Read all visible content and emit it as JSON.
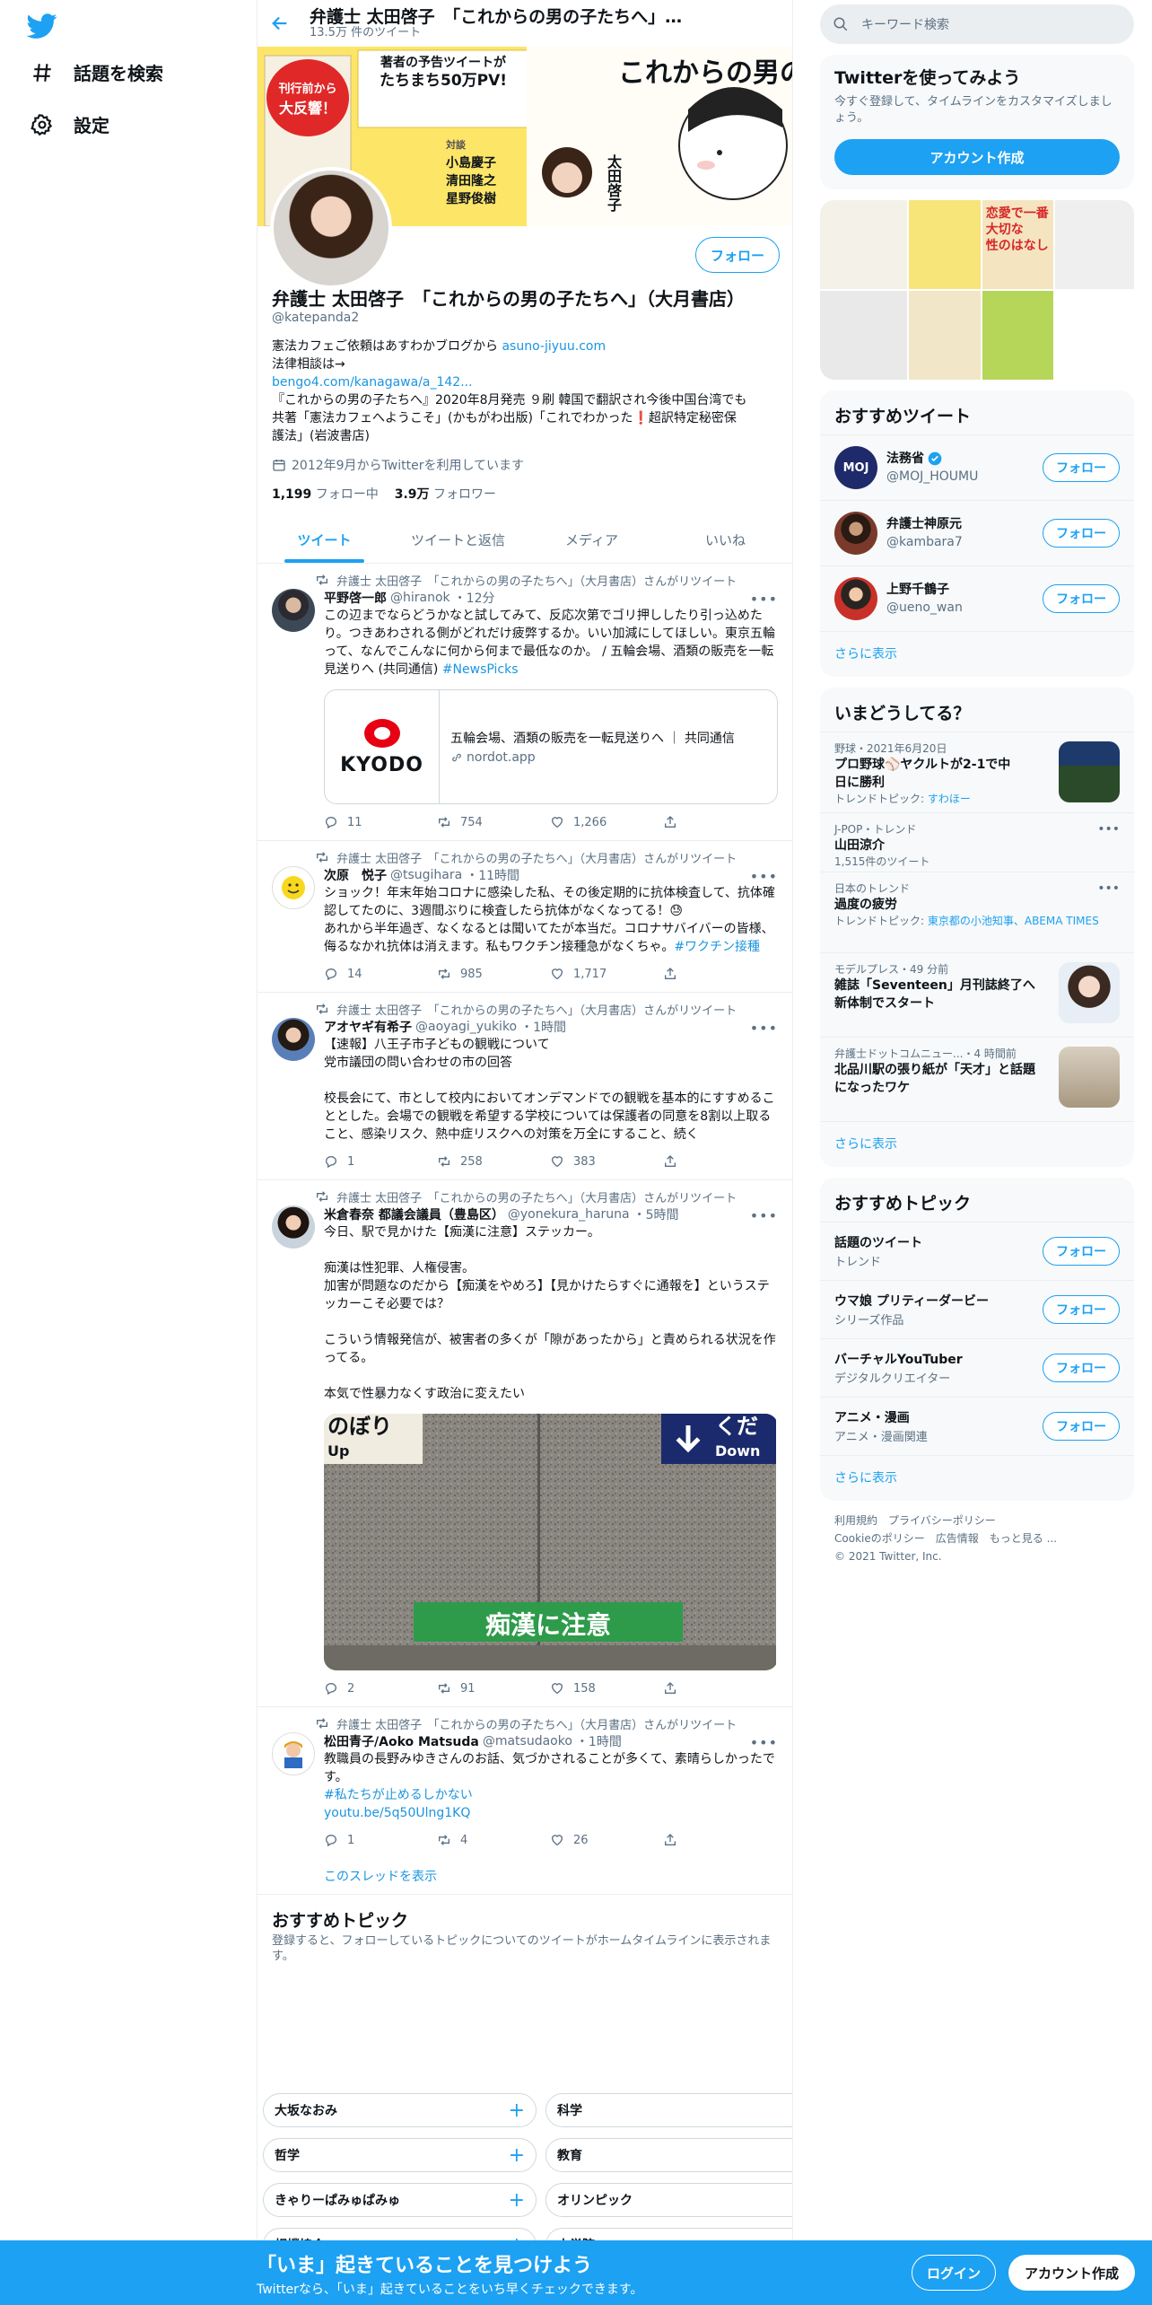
{
  "nav": {
    "logo_icon": "twitter-bird-icon",
    "items": [
      {
        "label": "話題を検索",
        "icon": "hashtag-icon"
      },
      {
        "label": "設定",
        "icon": "gear-icon"
      }
    ]
  },
  "header": {
    "title": "弁護士 太田啓子　「これからの男の子たちへ」…",
    "subtitle": "13.5万 件のツイート"
  },
  "banner": {
    "line1": "刊行前から",
    "line2": "大反響！",
    "line3": "著者の予告ツイートが",
    "line4": "たちまち50万PV!",
    "title": "これからの男の子たちへ",
    "names": [
      "小島慶子",
      "清田隆之",
      "星野俊樹",
      "太田啓子"
    ],
    "taidan": "対談"
  },
  "profile": {
    "follow_label": "フォロー",
    "name": "弁護士 太田啓子　「これからの男の子たちへ」（大月書店）",
    "handle": "@katepanda2",
    "bio_line1_text": "憲法カフェご依頼はあすわかブログから ",
    "bio_line1_link": "asuno-jiyuu.com",
    "bio_line2": "法律相談は→",
    "bio_line3_link": "bengo4.com/kanagawa/a_142...",
    "bio_line4": "『これからの男の子たちへ』2020年8月発売 ９刷 韓国で翻訳され今後中国台湾でも",
    "bio_line5": "共著「憲法カフェへようこそ」(かもがわ出版)「これでわかった❗️超訳特定秘密保",
    "bio_line6": "護法」(岩波書店)",
    "joined": "2012年9月からTwitterを利用しています",
    "following_count": "1,199",
    "following_label": "フォロー中",
    "followers_count": "3.9万",
    "followers_label": "フォロワー"
  },
  "tabs": [
    "ツイート",
    "ツイートと返信",
    "メディア",
    "いいね"
  ],
  "retweeted_by": "弁護士 太田啓子　「これからの男の子たちへ」（大月書店）さんがリツイート",
  "tweets": [
    {
      "name": "平野啓一郎",
      "handle": "@hiranok",
      "time": "・12分",
      "text": "この辺までならどうかなと試してみて、反応次第でゴリ押ししたり引っ込めたり。つきあわされる側がどれだけ疲弊するか。いい加減にしてほしい。東京五輪って、なんでこんなに何から何まで最低なのか。 / 五輪会場、酒類の販売を一転見送りへ (共同通信) ",
      "hashtag": "#NewsPicks",
      "card_logo": "KYODO",
      "card_title": "五輪会場、酒類の販売を一転見送りへ ｜ 共同通信",
      "card_domain": "nordot.app",
      "replies": "11",
      "retweets": "754",
      "likes": "1,266"
    },
    {
      "name": "次原　悦子",
      "handle": "@tsugihara",
      "time": "・11時間",
      "text": "ショック！年末年始コロナに感染した私、その後定期的に抗体検査して、抗体確認してたのに、3週間ぶりに検査したら抗体がなくなってる！😓\nあれから半年過ぎ、なくなるとは聞いてたが本当だ。コロナサバイバーの皆様、侮るなかれ抗体は消えます。私もワクチン接種急がなくちゃ。",
      "hashtag": "#ワクチン接種",
      "replies": "14",
      "retweets": "985",
      "likes": "1,717"
    },
    {
      "name": "アオヤギ有希子",
      "handle": "@aoyagi_yukiko",
      "time": "・1時間",
      "text": "【速報】八王子市子どもの観戦について\n党市議団の問い合わせの市の回答\n\n校長会にて、市として校内においてオンデマンドでの観戦を基本的にすすめることとした。会場での観戦を希望する学校については保護者の同意を8割以上取ること、感染リスク、熱中症リスクへの対策を万全にすること、続く",
      "replies": "1",
      "retweets": "258",
      "likes": "383"
    },
    {
      "name": "米倉春奈 都議会議員（豊島区）",
      "handle": "@yonekura_haruna",
      "time": "・5時間",
      "text": "今日、駅で見かけた【痴漢に注意】ステッカー。\n\n痴漢は性犯罪、人権侵害。\n加害が問題なのだから【痴漢をやめろ】【見かけたらすぐに通報を】というステッカーこそ必要では？\n\nこういう情報発信が、被害者の多くが「隙があったから」と責められる状況を作ってる。\n\n本気で性暴力なくす政治に変えたい",
      "media_sign_left": "のぼり",
      "media_sign_left_sub": "Up",
      "media_sign_right": "くだ",
      "media_sign_right_sub": "Down",
      "media_sticker": "痴漢に注意",
      "replies": "2",
      "retweets": "91",
      "likes": "158"
    },
    {
      "name": "松田青子/Aoko Matsuda",
      "handle": "@matsudaoko",
      "time": "・1時間",
      "text": "教職員の長野みゆきさんのお話、気づかされることが多くて、素晴らしかったです。",
      "hashtag": "#私たちが止めるしかない",
      "link": "youtu.be/5q50Ulng1KQ",
      "replies": "1",
      "retweets": "4",
      "likes": "26",
      "thread_label": "このスレッドを表示"
    }
  ],
  "recommended_topics_center": {
    "title": "おすすめトピック",
    "desc": "登録すると、フォローしているトピックについてのツイートがホームタイムラインに表示されます。",
    "chips": [
      [
        "大坂なおみ",
        "科学"
      ],
      [
        "哲学",
        "教育"
      ],
      [
        "きゃりーぱみゅぱみゅ",
        "オリンピック"
      ],
      [
        "相撲協会",
        "大学院"
      ]
    ]
  },
  "sidebar": {
    "search_placeholder": "キーワード検索",
    "signup_title": "Twitterを使ってみよう",
    "signup_desc": "今すぐ登録して、タイムラインをカスタマイズしましょう。",
    "signup_button": "アカウント作成",
    "photo_grid_texts": [
      "恋愛で一番大切な",
      "性のはなし"
    ],
    "who_title": "おすすめツイート",
    "who": [
      {
        "name": "法務省",
        "handle": "@MOJ_HOUMU",
        "verified": true,
        "avatar_text": "MOJ"
      },
      {
        "name": "弁護士神原元",
        "handle": "@kambara7",
        "verified": false
      },
      {
        "name": "上野千鶴子",
        "handle": "@ueno_wan",
        "verified": false
      }
    ],
    "follow_label": "フォロー",
    "show_more": "さらに表示",
    "trends_title": "いまどうしてる？",
    "trends": [
      {
        "meta": "野球・2021年6月20日",
        "title": "プロ野球⚾ヤクルトが2-1で中日に勝利",
        "sub_prefix": "トレンドトピック: ",
        "sub_link": "すわほー"
      },
      {
        "meta": "J-POP・トレンド",
        "title": "山田涼介",
        "sub_prefix": "1,515件のツイート",
        "sub_link": ""
      },
      {
        "meta": "日本のトレンド",
        "title": "過度の疲労",
        "sub_prefix": "トレンドトピック: ",
        "sub_link": "東京都の小池知事、ABEMA TIMES"
      },
      {
        "meta": "モデルプレス・49 分前",
        "title": "雑誌「Seventeen」月刊誌終了へ 新体制でスタート",
        "sub_prefix": "",
        "sub_link": ""
      },
      {
        "meta": "弁護士ドットコムニュー...・4 時間前",
        "title": "北品川駅の張り紙が「天才」と話題になったワケ",
        "sub_prefix": "",
        "sub_link": ""
      }
    ],
    "topics_title": "おすすめトピック",
    "topics": [
      {
        "name": "話題のツイート",
        "cat": "トレンド"
      },
      {
        "name": "ウマ娘 プリティーダービー",
        "cat": "シリーズ作品"
      },
      {
        "name": "バーチャルYouTuber",
        "cat": "デジタルクリエイター"
      },
      {
        "name": "アニメ・漫画",
        "cat": "アニメ・漫画関連"
      }
    ],
    "footer": [
      "利用規約",
      "プライバシーポリシー",
      "Cookieのポリシー",
      "広告情報",
      "もっと見る ...",
      "© 2021 Twitter, Inc."
    ]
  },
  "bottombar": {
    "title": "「いま」起きていることを見つけよう",
    "subtitle": "Twitterなら、「いま」起きていることをいち早くチェックできます。",
    "login": "ログイン",
    "signup": "アカウント作成"
  },
  "colors": {
    "accent": "#1da1f2",
    "link": "#1b95e0",
    "secondary_text": "#5b7083"
  }
}
